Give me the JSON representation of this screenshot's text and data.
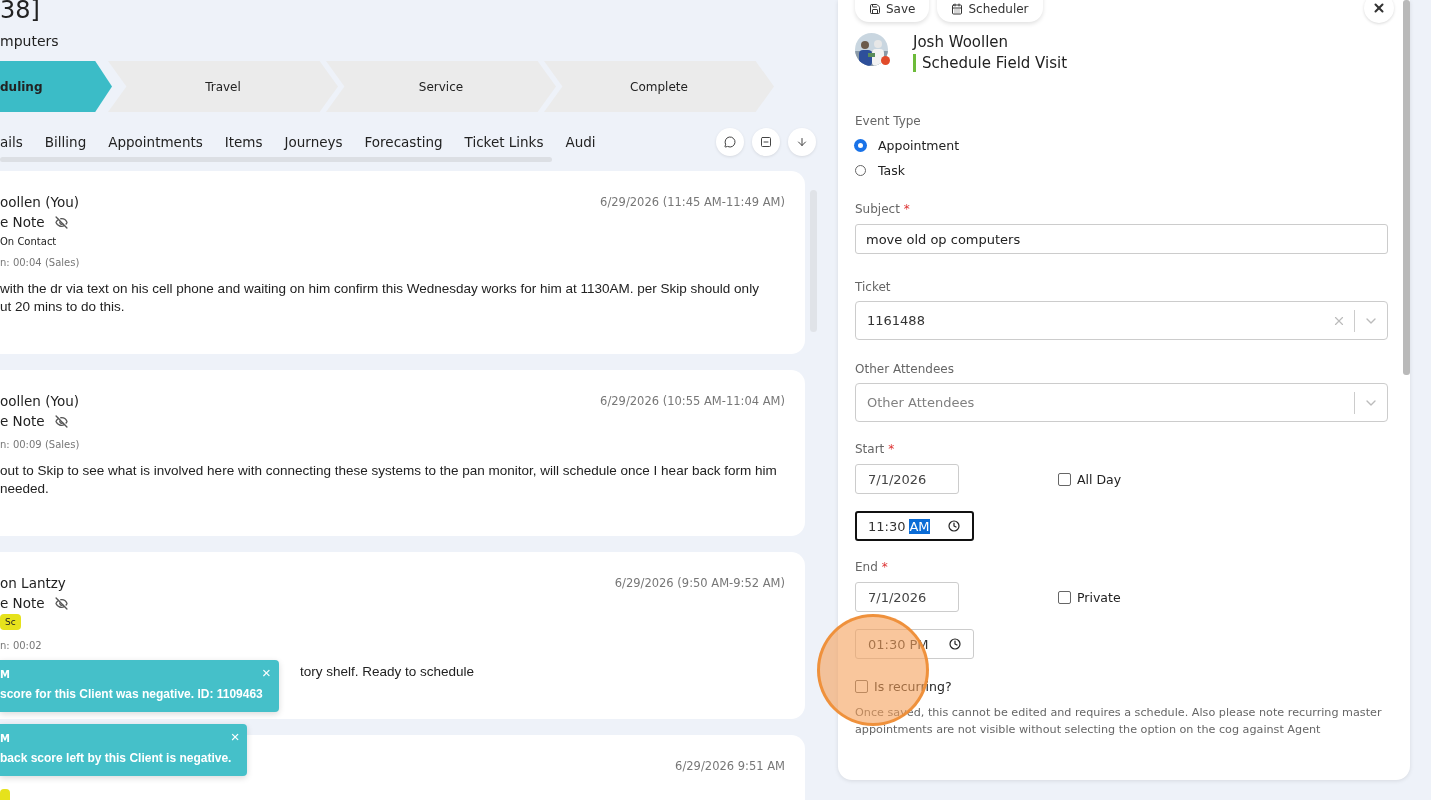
{
  "header": {
    "title": "38]",
    "subtitle": "mputers"
  },
  "stepper": [
    {
      "label": "duling",
      "selected": true
    },
    {
      "label": "Travel",
      "selected": false
    },
    {
      "label": "Service",
      "selected": false
    },
    {
      "label": "Complete",
      "selected": false
    }
  ],
  "tabs": [
    "ails",
    "Billing",
    "Appointments",
    "Items",
    "Journeys",
    "Forecasting",
    "Ticket Links",
    "Audi"
  ],
  "notes": [
    {
      "author": "oollen (You)",
      "note_type": "e Note",
      "private": true,
      "contact": "On Contact",
      "duration": "n: 00:04 (Sales)",
      "body": [
        "with the dr via text on his cell phone and waiting on him confirm this Wednesday works for him at 1130AM.  per Skip should only",
        "ut 20 mins to do this."
      ],
      "date": "6/29/2026 (11:45 AM-11:49 AM)"
    },
    {
      "author": "oollen (You)",
      "note_type": "e Note",
      "private": true,
      "duration": "n: 00:09 (Sales)",
      "body": [
        "out to Skip to see what is involved here with connecting these systems to the pan monitor, will schedule once I hear back form him",
        "needed."
      ],
      "date": "6/29/2026 (10:55 AM-11:04 AM)"
    },
    {
      "author": "on Lantzy",
      "note_type": "e Note",
      "private": true,
      "tag": {
        "label": "Sc",
        "color": "#e6e21c"
      },
      "duration": "n: 00:02",
      "body": [
        "tory shelf. Ready to schedule"
      ],
      "obscured": true,
      "date": "6/29/2026 (9:50 AM-9:52 AM)"
    },
    {
      "tag": {
        "color": "#e6e21c"
      },
      "date": "6/29/2026 9:51 AM"
    }
  ],
  "toasts": [
    {
      "title": "M",
      "message": "score for this Client was negative. ID: 1109463",
      "close": "×"
    },
    {
      "title": "M",
      "message": "back score left by this Client is negative.",
      "close": "×"
    }
  ],
  "panel": {
    "buttons": [
      "Save",
      "Scheduler"
    ],
    "user": {
      "name": "Josh Woollen",
      "subtitle": "Schedule Field Visit"
    },
    "event_type": {
      "label": "Event Type",
      "options": [
        {
          "label": "Appointment",
          "selected": true
        },
        {
          "label": "Task",
          "selected": false
        }
      ]
    },
    "subject": {
      "label": "Subject",
      "required_mark": "*",
      "value": "move old op computers"
    },
    "ticket": {
      "label": "Ticket",
      "value": "1161488",
      "clearable": true
    },
    "attendees": {
      "label": "Other Attendees",
      "placeholder": "Other Attendees"
    },
    "start": {
      "label": "Start",
      "required_mark": "*",
      "date": "7/1/2026",
      "time": "11:30",
      "period": "AM",
      "focused": true,
      "option": {
        "label": "All Day",
        "checked": false
      }
    },
    "end": {
      "label": "End",
      "required_mark": "*",
      "date": "7/1/2026",
      "time": "01:30",
      "period": "PM",
      "focused": false,
      "option": {
        "label": "Private",
        "checked": false
      }
    },
    "recurring": {
      "label": "Is recurring?",
      "checked": false
    },
    "note": "Once saved, this cannot be edited and requires a schedule. Also please note recurring master appointments are not visible without selecting the option on the cog against Agent"
  },
  "click_marker": {
    "shown": true
  }
}
